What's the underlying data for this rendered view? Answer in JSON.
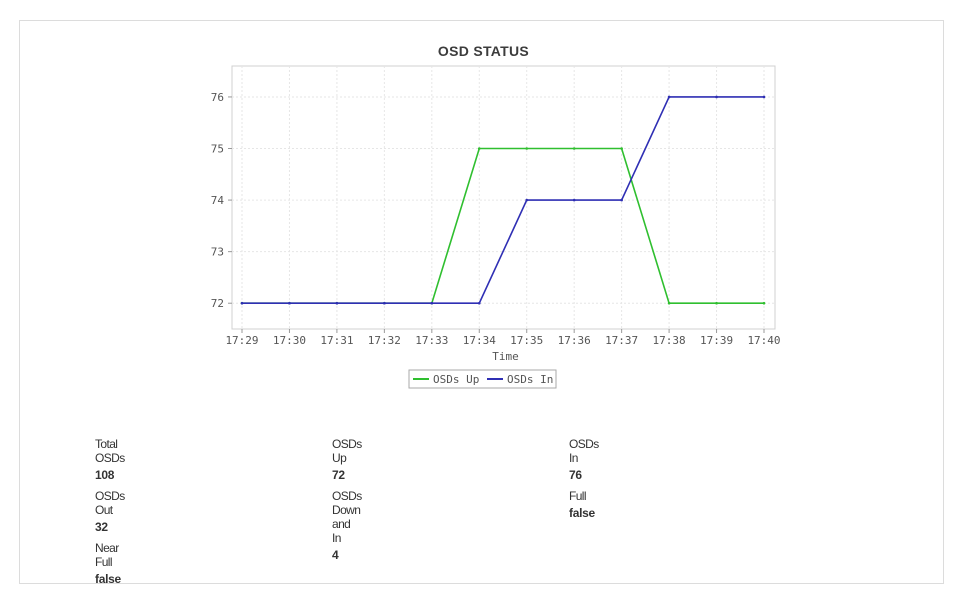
{
  "chart_data": {
    "type": "line",
    "title": "OSD STATUS",
    "xlabel": "Time",
    "ylabel": "",
    "x": [
      "17:29",
      "17:30",
      "17:31",
      "17:32",
      "17:33",
      "17:34",
      "17:35",
      "17:36",
      "17:37",
      "17:38",
      "17:39",
      "17:40"
    ],
    "ylim": [
      71.5,
      76.6
    ],
    "yticks": [
      72,
      73,
      74,
      75,
      76
    ],
    "grid": true,
    "legend": "bottom",
    "series": [
      {
        "name": "OSDs Up",
        "color": "#2fbf2f",
        "values": [
          72,
          72,
          72,
          72,
          72,
          75,
          75,
          75,
          75,
          72,
          72,
          72
        ]
      },
      {
        "name": "OSDs In",
        "color": "#2f2fb4",
        "values": [
          72,
          72,
          72,
          72,
          72,
          72,
          74,
          74,
          74,
          76,
          76,
          76
        ]
      }
    ]
  },
  "stats": [
    {
      "label": "Total OSDs",
      "value": "108"
    },
    {
      "label": "OSDs Up",
      "value": "72"
    },
    {
      "label": "OSDs In",
      "value": "76"
    },
    {
      "label": "OSDs Out",
      "value": "32"
    },
    {
      "label": "OSDs Down and In",
      "value": "4"
    },
    {
      "label": "Full",
      "value": "false"
    },
    {
      "label": "Near Full",
      "value": "false"
    }
  ]
}
